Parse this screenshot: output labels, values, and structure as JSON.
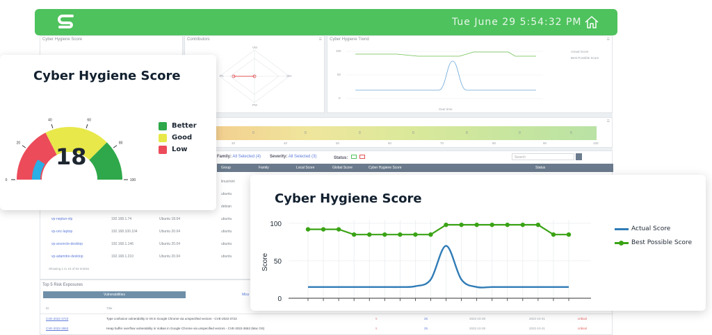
{
  "topbar": {
    "clock": "Tue June 29 5:54:32 PM",
    "logo_icon": "s-logo-icon",
    "home_icon": "home-icon",
    "color": "#4ec25d"
  },
  "background": {
    "panel_cyber": "Cyber Hygiene Score",
    "panel_contributors": "Contributors",
    "panel_trend": "Cyber Hygiene Trend",
    "radar_labels": [
      "VM",
      "PA",
      "CKI",
      "PM"
    ],
    "trend_legend": [
      "Actual Score",
      "Best Possible Score"
    ],
    "trend_ylabel": "Score",
    "trend_xlabel": "Over time",
    "trend_ticks": [
      "100",
      "50",
      "0"
    ],
    "heat_values": [
      "0",
      "0",
      "0",
      "0",
      "0",
      "0",
      "0"
    ],
    "heat_axis": [
      "30",
      "40",
      "50",
      "60",
      "70",
      "80",
      "90",
      "100"
    ],
    "filters": {
      "family_label": "Family:",
      "family_value": "All Selected (4)",
      "severity_label": "Severity:",
      "severity_value": "All Selected (3)",
      "status_label": "Status:",
      "search_placeholder": "Search"
    },
    "table_headers": [
      "Group",
      "Family",
      "Local Score",
      "Global Score",
      "Cyber Hygiene Score",
      "Status"
    ],
    "rows": [
      {
        "name": "",
        "ip": "",
        "os": "",
        "family": "linuxmint"
      },
      {
        "name": "",
        "ip": "",
        "os": "",
        "family": "ubuntu"
      },
      {
        "name": "",
        "ip": "",
        "os": "",
        "family": "debian"
      },
      {
        "name": "vp-neptun-vlp",
        "ip": "192.168.1.74",
        "os": "Ubuntu 18.04",
        "family": "ubuntu"
      },
      {
        "name": "vp-onc-laptop",
        "ip": "192.168.100.104",
        "os": "Ubuntu 20.04",
        "family": "ubuntu"
      },
      {
        "name": "vp-arsoncle-desktop",
        "ip": "192.168.1.146",
        "os": "Ubuntu 20.04",
        "family": "ubuntu"
      },
      {
        "name": "vp-adamitre-desktop",
        "ip": "192.168.1.210",
        "os": "Ubuntu 20.04",
        "family": "ubuntu"
      }
    ],
    "entries_text": "Showing 1 to 10 of 63 entries",
    "risk_title": "Top 5 Risk Exposures",
    "risk_tab": "Vulnerabilities",
    "risk_tab2": "Miss",
    "risk_headers": [
      "ID",
      "Title"
    ],
    "risks": [
      {
        "id": "CVE-2022-3723",
        "title": "Type confusion vulnerability in V8 in Google Chrome via unspecified vectors - CVE-2022-3723",
        "a": "5",
        "b": "25",
        "d1": "2022-10-28",
        "d2": "2022-10-31",
        "sev": "critical"
      },
      {
        "id": "CVE-2022-3653",
        "title": "Heap buffer overflow vulnerability in Vulkan in Google Chrome via unspecified vectors - CVE-2022-3653 (Mac OS)",
        "a": "5",
        "b": "25",
        "d1": "2022-10-28",
        "d2": "2022-10-31",
        "sev": "critical"
      }
    ]
  },
  "gauge_card": {
    "title": "Cyber Hygiene Score",
    "value": "18",
    "score_fraction": 0.18,
    "ticks": [
      "0",
      "20",
      "40",
      "60",
      "80",
      "100"
    ],
    "legend": [
      {
        "label": "Better",
        "color": "#2ea84a"
      },
      {
        "label": "Good",
        "color": "#e8e84a"
      },
      {
        "label": "Low",
        "color": "#ec4b5a"
      }
    ]
  },
  "trend_card": {
    "title": "Cyber Hygiene Score",
    "ylabel": "Score",
    "legend": [
      {
        "label": "Actual Score",
        "color": "#2f7bb6"
      },
      {
        "label": "Best Possible Score",
        "color": "#3aa315"
      }
    ]
  },
  "chart_data": {
    "type": "line",
    "title": "Cyber Hygiene Score",
    "xlabel": "",
    "ylabel": "Score",
    "ylim": [
      0,
      100
    ],
    "yticks": [
      0,
      50,
      100
    ],
    "series": [
      {
        "name": "Best Possible Score",
        "values": [
          92,
          92,
          92,
          85,
          85,
          85,
          85,
          85,
          85,
          98,
          98,
          98,
          98,
          98,
          98,
          98,
          85,
          85
        ]
      },
      {
        "name": "Actual Score",
        "values": [
          15,
          15,
          15,
          15,
          15,
          15,
          15,
          16,
          25,
          70,
          25,
          15,
          15,
          15,
          15,
          15,
          15,
          15
        ]
      }
    ]
  }
}
